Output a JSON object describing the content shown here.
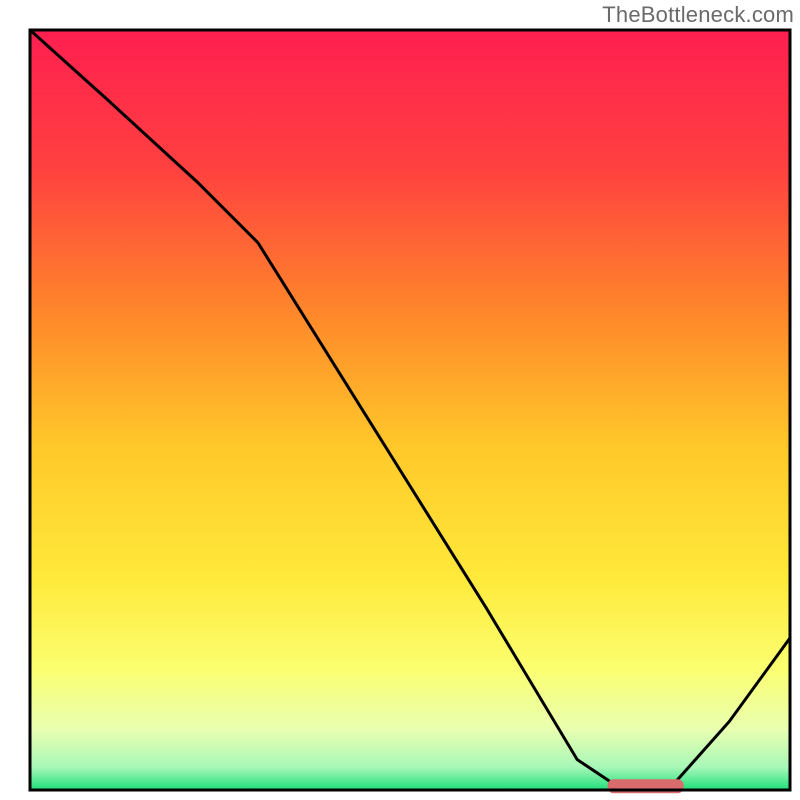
{
  "watermark": "TheBottleneck.com",
  "chart_data": {
    "type": "line",
    "title": "",
    "xlabel": "",
    "ylabel": "",
    "xlim": [
      0,
      100
    ],
    "ylim": [
      0,
      100
    ],
    "grid": false,
    "background_gradient": {
      "stops": [
        {
          "offset": 0.0,
          "color": "#ff1f50"
        },
        {
          "offset": 0.18,
          "color": "#ff4040"
        },
        {
          "offset": 0.38,
          "color": "#ff8a2a"
        },
        {
          "offset": 0.55,
          "color": "#ffc92a"
        },
        {
          "offset": 0.72,
          "color": "#ffe93a"
        },
        {
          "offset": 0.84,
          "color": "#fbff70"
        },
        {
          "offset": 0.92,
          "color": "#e9ffb0"
        },
        {
          "offset": 0.97,
          "color": "#a8f7b8"
        },
        {
          "offset": 1.0,
          "color": "#1fe07a"
        }
      ]
    },
    "series": [
      {
        "name": "bottleneck-curve",
        "x": [
          0,
          10,
          22,
          30,
          45,
          60,
          72,
          78,
          84,
          92,
          100
        ],
        "values": [
          100,
          91,
          80,
          72,
          48,
          24,
          4,
          0,
          0,
          9,
          20
        ]
      }
    ],
    "marker": {
      "name": "optimal-range",
      "x_start": 76,
      "x_end": 86,
      "y": 0.5,
      "color": "#d86b6b"
    },
    "border_color": "#000000",
    "border_width": 3
  }
}
